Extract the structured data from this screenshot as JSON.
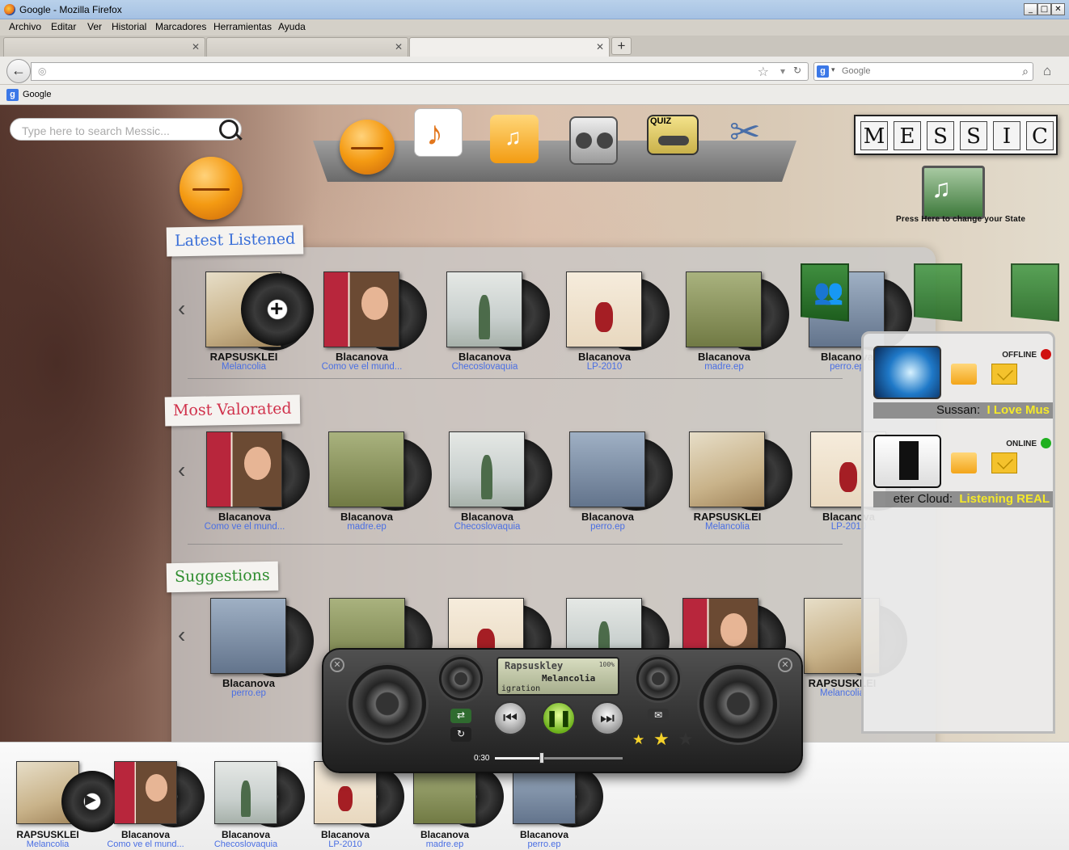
{
  "window": {
    "title": "Google - Mozilla Firefox",
    "min": "_",
    "max": "□",
    "close": "✕"
  },
  "menu": [
    "Archivo",
    "Editar",
    "Ver",
    "Historial",
    "Marcadores",
    "Herramientas",
    "Ayuda"
  ],
  "tabs": [
    {
      "label": ""
    },
    {
      "label": ""
    },
    {
      "label": ""
    }
  ],
  "nav": {
    "url": "",
    "search_engine": "Google",
    "search_placeholder": "Google"
  },
  "bookmarks": [
    {
      "label": "Google"
    }
  ],
  "app": {
    "search_placeholder": "Type here to search Messic...",
    "logo_letters": [
      {
        "l": "M",
        "n": "3"
      },
      {
        "l": "E",
        "n": "1"
      },
      {
        "l": "S",
        "n": "1"
      },
      {
        "l": "S",
        "n": "1"
      },
      {
        "l": "I",
        "n": "1"
      },
      {
        "l": "C",
        "n": "3"
      }
    ],
    "state_label": "Press Here to change your State",
    "toolbar_icons": [
      "user-icon",
      "playlist-icon",
      "folder-music-icon",
      "radio-icon",
      "quiz-cassette-icon",
      "tools-icon"
    ],
    "quiz_text": "QUIZ",
    "sections": [
      {
        "label": "Latest Listened",
        "color": "#3a6fd8",
        "albums": [
          {
            "artist": "RAPSUSKLEI",
            "title": "Melancolia",
            "cover": "cv1"
          },
          {
            "artist": "Blacanova",
            "title": "Como ve el mund...",
            "cover": "cv2 cv-boy"
          },
          {
            "artist": "Blacanova",
            "title": "Checoslovaquia",
            "cover": "cv3 cv-tree"
          },
          {
            "artist": "Blacanova",
            "title": "LP-2010",
            "cover": "cv4 cv-fig"
          },
          {
            "artist": "Blacanova",
            "title": "madre.ep",
            "cover": "cv5"
          },
          {
            "artist": "Blacanova",
            "title": "perro.ep",
            "cover": "cv6"
          }
        ]
      },
      {
        "label": "Most Valorated",
        "color": "#d0304a",
        "albums": [
          {
            "artist": "Blacanova",
            "title": "Como ve el mund...",
            "cover": "cv2 cv-boy"
          },
          {
            "artist": "Blacanova",
            "title": "madre.ep",
            "cover": "cv5"
          },
          {
            "artist": "Blacanova",
            "title": "Checoslovaquia",
            "cover": "cv3 cv-tree"
          },
          {
            "artist": "Blacanova",
            "title": "perro.ep",
            "cover": "cv6"
          },
          {
            "artist": "RAPSUSKLEI",
            "title": "Melancolia",
            "cover": "cv1"
          },
          {
            "artist": "Blacanova",
            "title": "LP-2010",
            "cover": "cv4 cv-fig"
          }
        ]
      },
      {
        "label": "Suggestions",
        "color": "#2f8d2f",
        "albums": [
          {
            "artist": "Blacanova",
            "title": "perro.ep",
            "cover": "cv6"
          },
          {
            "artist": "",
            "title": "",
            "cover": "cv5"
          },
          {
            "artist": "",
            "title": "",
            "cover": "cv4 cv-fig"
          },
          {
            "artist": "",
            "title": "",
            "cover": "cv3 cv-tree"
          },
          {
            "artist": "",
            "title": "",
            "cover": "cv2 cv-boy"
          },
          {
            "artist": "RAPSUSKLEI",
            "title": "Melancolia",
            "cover": "cv1"
          }
        ]
      }
    ],
    "friends": [
      {
        "name": "Sussan:",
        "message": "I Love Mus",
        "status": "OFFLINE",
        "status_color": "#d01010"
      },
      {
        "name": "eter Cloud:",
        "message": "Listening REAL",
        "status": "ONLINE",
        "status_color": "#20b020"
      }
    ],
    "player": {
      "artist": "Rapsuskley",
      "album": "Melancolia",
      "song": "igration",
      "volume": "100%",
      "time": "0:30",
      "rating": 2,
      "max_rating": 3,
      "progress": 0.37
    },
    "queue": [
      {
        "artist": "RAPSUSKLEI",
        "title": "Melancolia",
        "cover": "cv1"
      },
      {
        "artist": "Blacanova",
        "title": "Como ve el mund...",
        "cover": "cv2 cv-boy"
      },
      {
        "artist": "Blacanova",
        "title": "Checoslovaquia",
        "cover": "cv3 cv-tree"
      },
      {
        "artist": "Blacanova",
        "title": "LP-2010",
        "cover": "cv4 cv-fig"
      },
      {
        "artist": "Blacanova",
        "title": "madre.ep",
        "cover": "cv5"
      },
      {
        "artist": "Blacanova",
        "title": "perro.ep",
        "cover": "cv6"
      }
    ]
  }
}
